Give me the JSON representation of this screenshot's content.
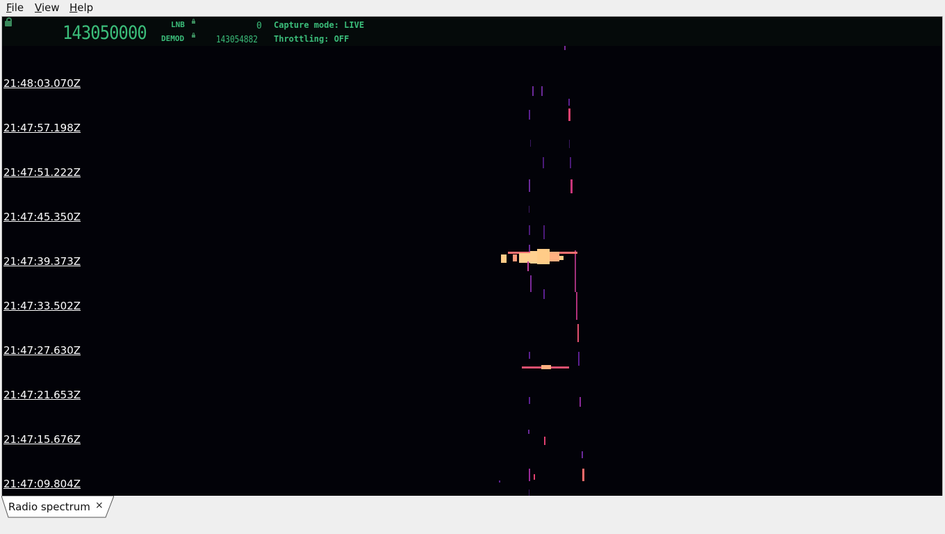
{
  "menu": {
    "file": "File",
    "view": "View",
    "help": "Help"
  },
  "header": {
    "main_frequency": "143050000",
    "lnb_label": "LNB",
    "lnb_value": "0",
    "demod_label": "DEMOD",
    "demod_value": "143054882",
    "capture_mode": "Capture mode: LIVE",
    "throttling": "Throttling: OFF"
  },
  "timestamps": [
    "21:48:03.070Z",
    "21:47:57.198Z",
    "21:47:51.222Z",
    "21:47:45.350Z",
    "21:47:39.373Z",
    "21:47:33.502Z",
    "21:47:27.630Z",
    "21:47:21.653Z",
    "21:47:15.676Z",
    "21:47:09.804Z"
  ],
  "tabs": [
    {
      "label": "Radio spectrum",
      "close": "×"
    }
  ],
  "colors": {
    "accent": "#3bbd7a",
    "background": "#020208",
    "signal_hot": "#ffcc88",
    "signal_mid": "#e0407a",
    "signal_low": "#6a2a9a"
  }
}
